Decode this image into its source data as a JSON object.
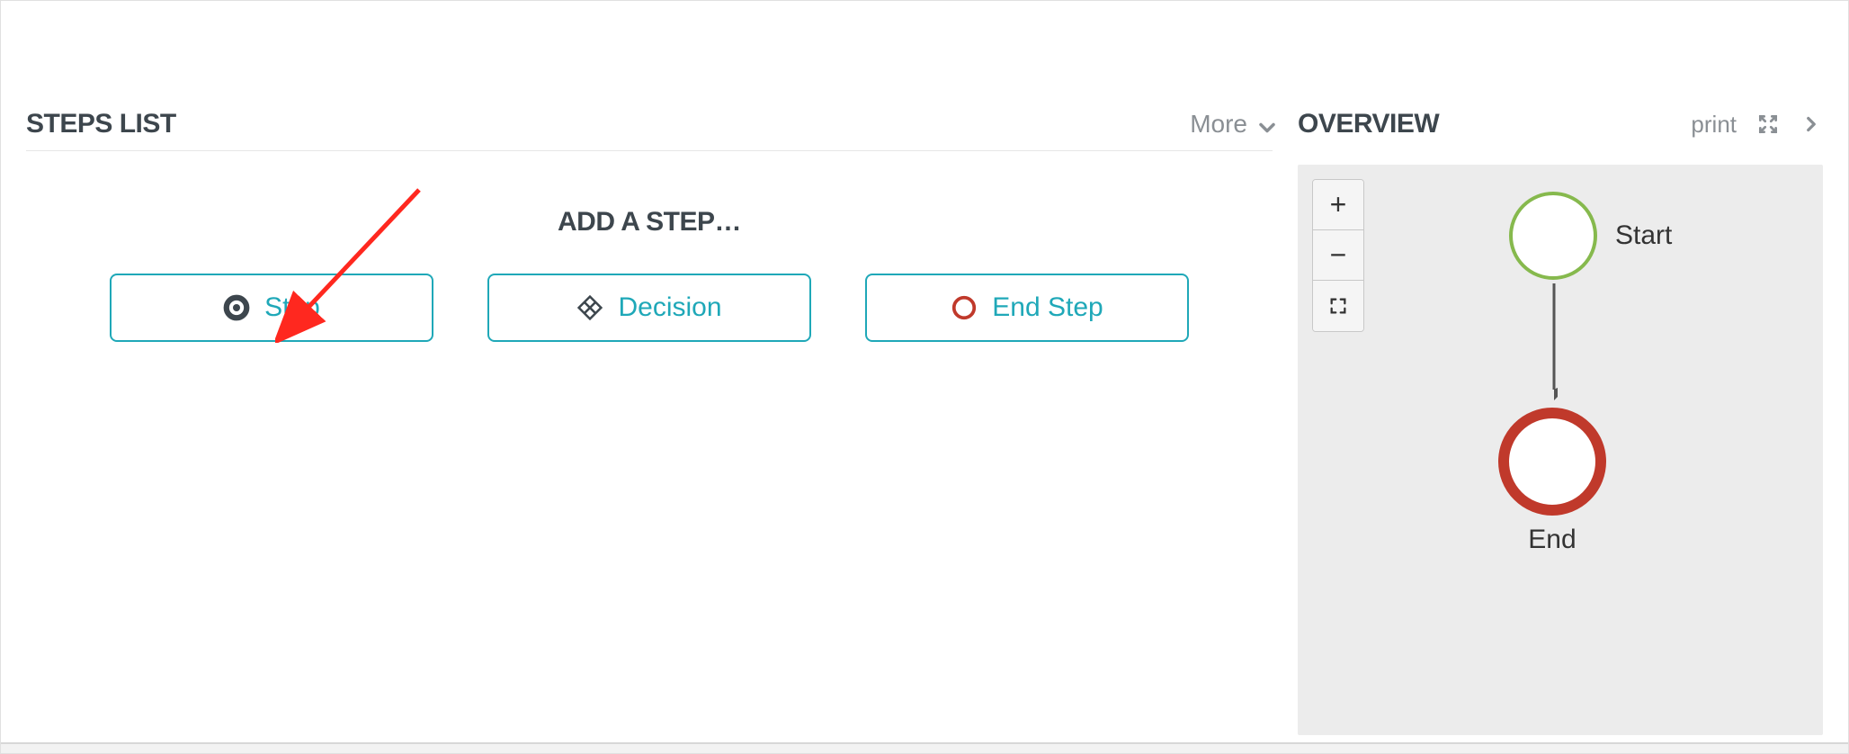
{
  "steps_list": {
    "title": "STEPS LIST",
    "more_label": "More",
    "section_label": "ADD A STEP…",
    "buttons": {
      "step": "Step",
      "decision": "Decision",
      "end_step": "End Step"
    }
  },
  "overview": {
    "title": "OVERVIEW",
    "print_label": "print",
    "zoom": {
      "in": "+",
      "out": "−"
    },
    "nodes": {
      "start": "Start",
      "end": "End"
    }
  },
  "colors": {
    "accent": "#1fa8b8",
    "start_node": "#86b94d",
    "end_node": "#c0392b",
    "text_muted": "#8a8f94",
    "heading": "#3d464d",
    "annotation_arrow": "#ff281f"
  },
  "icons": {
    "step": "step-circle-icon",
    "decision": "decision-diamond-icon",
    "end_step": "end-step-circle-icon",
    "chevron_down": "chevron-down-icon",
    "chevron_right": "chevron-right-icon",
    "expand": "expand-icon",
    "fullscreen": "fullscreen-corners-icon"
  }
}
